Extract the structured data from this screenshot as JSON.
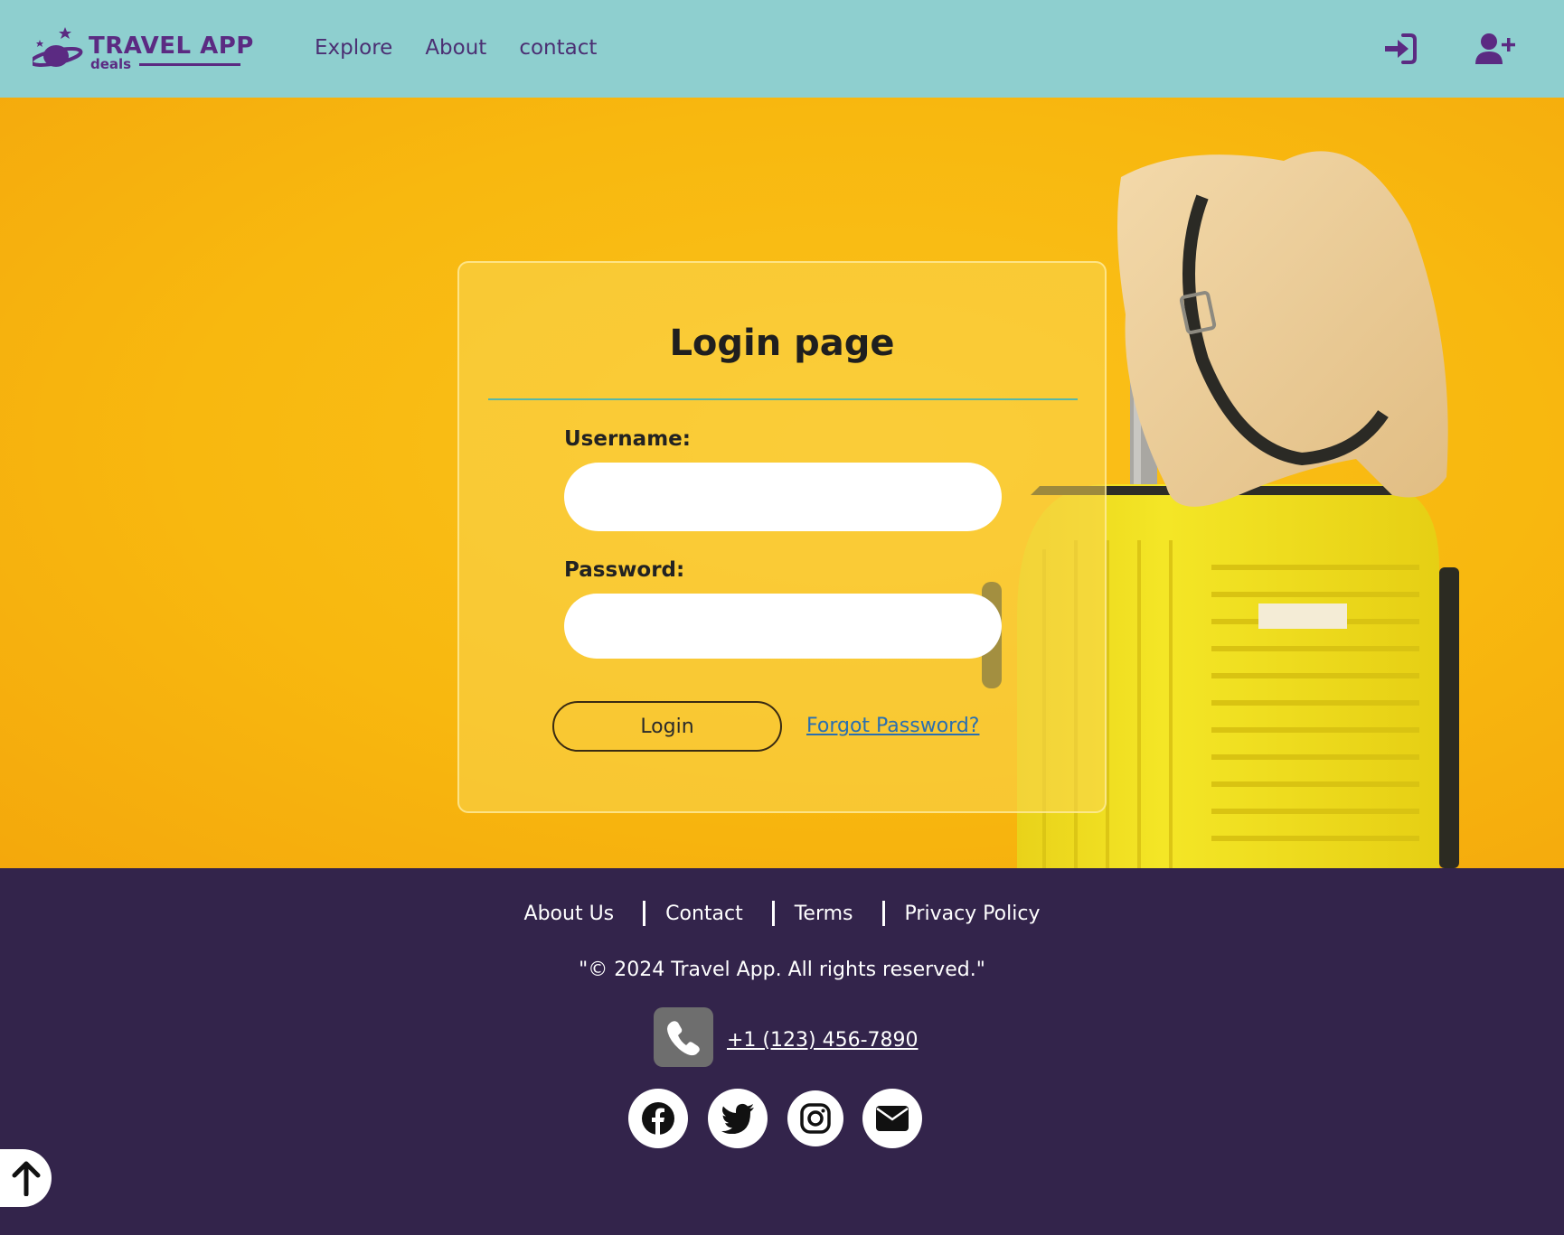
{
  "header": {
    "logo_text": "TRAVEL APP",
    "logo_sub": "deals",
    "nav": [
      "Explore",
      "About",
      "contact"
    ],
    "icons": [
      "sign-in-icon",
      "user-plus-icon"
    ]
  },
  "login": {
    "title": "Login page",
    "username_label": "Username:",
    "username_value": "",
    "password_label": "Password:",
    "password_value": "",
    "login_button": "Login",
    "forgot_link": "Forgot Password?"
  },
  "footer": {
    "links": [
      "About Us",
      "Contact",
      "Terms",
      "Privacy Policy"
    ],
    "copyright": "\"© 2024 Travel App. All rights reserved.\"",
    "phone": "+1 (123) 456-7890",
    "social_icons": [
      "facebook-icon",
      "twitter-icon",
      "instagram-icon",
      "envelope-icon"
    ]
  },
  "scroll_top_icon": "arrow-up-icon",
  "colors": {
    "header_bg": "#8ecfcf",
    "hero_bg": "#f8b80f",
    "footer_bg": "#33244b",
    "brand_purple": "#5b2a82",
    "link_blue": "#2a6fb0"
  }
}
